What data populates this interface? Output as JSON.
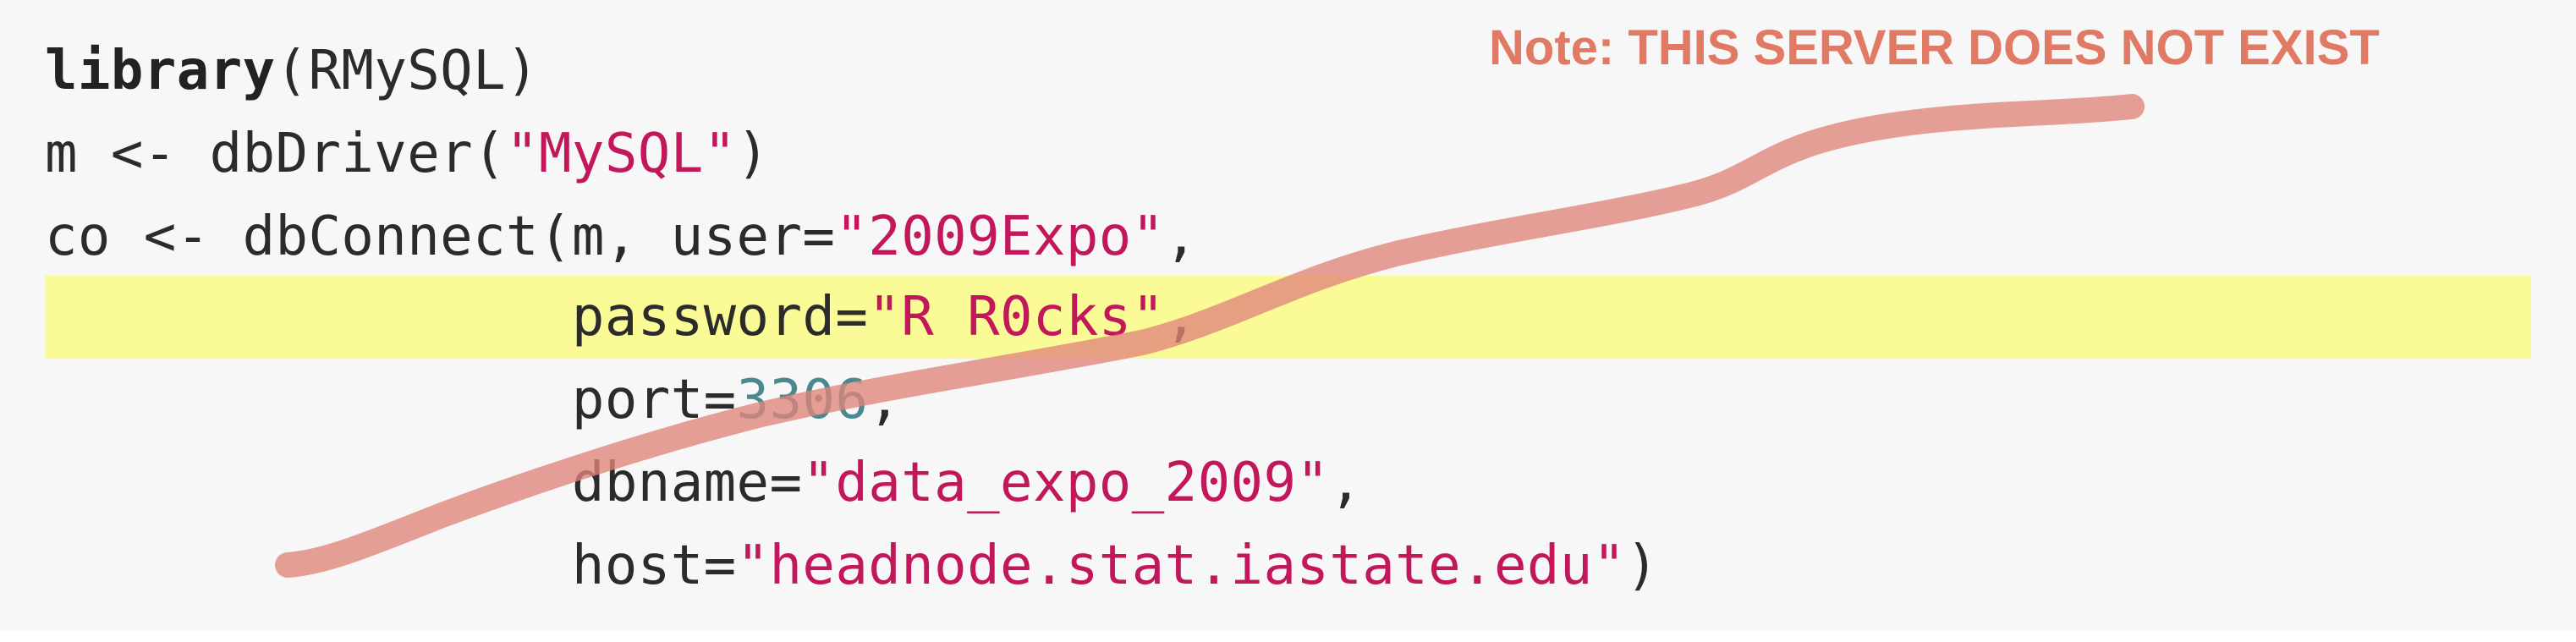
{
  "code": {
    "lines": [
      {
        "kw": "library",
        "rest": "(RMySQL)"
      },
      {
        "pre": "m <- dbDriver(",
        "str": "\"MySQL\"",
        "post": ")"
      },
      {
        "pre": "co <- dbConnect(m, user=",
        "str": "\"2009Expo\"",
        "post": ","
      },
      {
        "pre": "                password=",
        "str": "\"R R0cks\"",
        "post": ","
      },
      {
        "pre": "                port=",
        "num": "3306",
        "post": ","
      },
      {
        "pre": "                dbname=",
        "str": "\"data_expo_2009\"",
        "post": ","
      },
      {
        "pre": "                host=",
        "str": "\"headnode.stat.iastate.edu\"",
        "post": ")"
      }
    ],
    "highlighted_line": "password"
  },
  "annotation": {
    "note": "Note: THIS SERVER DOES NOT EXIST",
    "color": "#e07a64",
    "scribble_color": "#e0857a"
  },
  "colors": {
    "string": "#c2185b",
    "number": "#4a8a8f",
    "highlight": "#fafa96",
    "background": "#f7f7f7"
  }
}
